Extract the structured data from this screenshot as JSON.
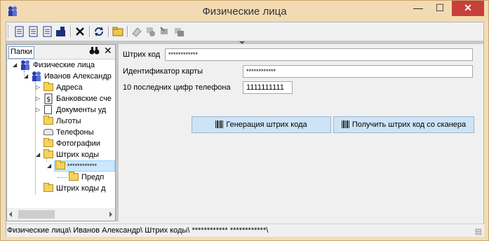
{
  "window": {
    "title": "Физические лица",
    "minimize": "—",
    "maximize": "☐",
    "close": "✕"
  },
  "left_panel": {
    "tab": "Папки",
    "close": "✕"
  },
  "tree": {
    "items": [
      {
        "label": "Физические лица"
      },
      {
        "label": "Иванов Александр"
      },
      {
        "label": "Адреса"
      },
      {
        "label": "Банковские сче"
      },
      {
        "label": "Документы уд"
      },
      {
        "label": "Льготы"
      },
      {
        "label": "Телефоны"
      },
      {
        "label": "Фотографии"
      },
      {
        "label": "Штрих коды"
      },
      {
        "label": "************"
      },
      {
        "label": "Предп"
      },
      {
        "label": "Штрих коды д"
      }
    ]
  },
  "form": {
    "barcode_label": "Штрих код",
    "barcode_value": "************",
    "card_label": "Идентификатор карты",
    "card_value": "************",
    "phone_label": "10 последних цифр телефона",
    "phone_value": "1111111111",
    "generate_button": "Генерация штрих кода",
    "scan_button": "Получить штрих код со сканера"
  },
  "statusbar": {
    "path": "Физические лица\\ Иванов Александр\\ Штрих коды\\ ************ ************\\"
  }
}
